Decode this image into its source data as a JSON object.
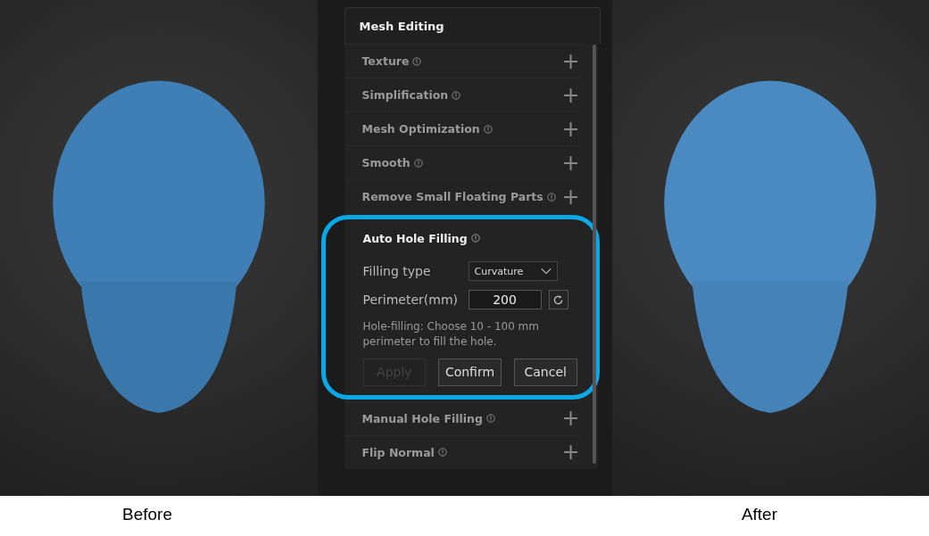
{
  "panel": {
    "title": "Mesh Editing",
    "sections": [
      {
        "kind": "collapsed",
        "label": "Texture",
        "toggle": "+"
      },
      {
        "kind": "collapsed",
        "label": "Simplification",
        "toggle": "+"
      },
      {
        "kind": "collapsed",
        "label": "Mesh Optimization",
        "toggle": "+"
      },
      {
        "kind": "collapsed",
        "label": "Smooth",
        "toggle": "+"
      },
      {
        "kind": "collapsed",
        "label": "Remove Small Floating Parts",
        "toggle": "+"
      },
      {
        "kind": "expanded",
        "label": "Auto Hole Filling",
        "highlighted": true,
        "fields": [
          {
            "kind": "dropdown",
            "label": "Filling type",
            "value": "Curvature"
          },
          {
            "kind": "number",
            "label": "Perimeter(mm)",
            "value": "200"
          }
        ],
        "hint": "Hole-filling:  Choose 10 - 100 mm perimeter to fill the hole.",
        "buttons": [
          {
            "label": "Apply",
            "disabled": true
          },
          {
            "label": "Confirm",
            "disabled": false
          },
          {
            "label": "Cancel",
            "disabled": false
          }
        ]
      },
      {
        "kind": "collapsed",
        "label": "Manual Hole Filling",
        "toggle": "+"
      },
      {
        "kind": "collapsed",
        "label": "Flip Normal",
        "toggle": "+"
      }
    ]
  },
  "captions": [
    "Before",
    "After"
  ]
}
